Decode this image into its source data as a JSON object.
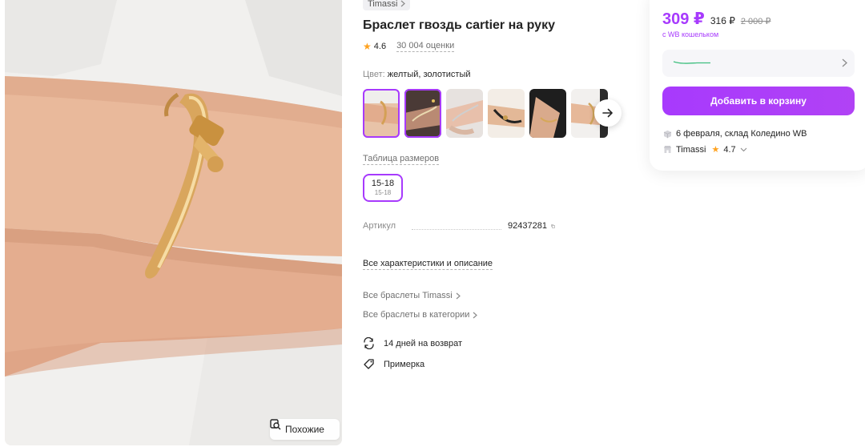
{
  "gallery": {
    "similar_button_label": "Похожие"
  },
  "product": {
    "brand": "Timassi",
    "title": "Браслет гвоздь cartier на руку",
    "rating": "4.6",
    "reviews": "30 004 оценки",
    "color_label": "Цвет:",
    "color_value": "желтый, золотистый",
    "thumbnails": [
      "thumb-1",
      "thumb-2",
      "thumb-3",
      "thumb-4",
      "thumb-5",
      "thumb-6"
    ],
    "size_table_label": "Таблица размеров",
    "size": {
      "label": "15-18",
      "sub": "15-18"
    },
    "article_label": "Артикул",
    "article_value": "92437281",
    "all_characteristics_label": "Все характеристики и описание",
    "links": {
      "all_brand_bracelets": "Все браслеты Timassi",
      "all_category_bracelets": "Все браслеты в категории"
    },
    "features": {
      "return": "14 дней на возврат",
      "fitting": "Примерка"
    }
  },
  "price_card": {
    "price": "309 ₽",
    "price_without_wallet": "316 ₽",
    "old_price": "2 000 ₽",
    "wallet_note": "с WB кошельком",
    "add_to_cart_label": "Добавить в корзину",
    "delivery": "6 февраля, склад Коледино WB",
    "seller_name": "Timassi",
    "seller_rating": "4.7"
  },
  "colors": {
    "accent": "#a73afd",
    "star": "#ffa21f",
    "muted_text": "#8b8b8b"
  },
  "icons": [
    "search-similar-icon",
    "chevron-right-icon",
    "arrow-right-icon",
    "copy-icon",
    "return-icon",
    "tag-icon",
    "box-icon",
    "shop-icon",
    "star-icon",
    "chevron-down-icon"
  ]
}
